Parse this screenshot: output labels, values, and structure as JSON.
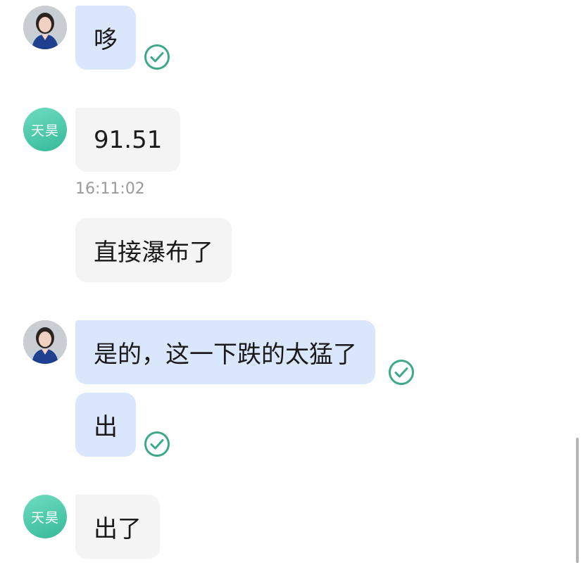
{
  "contacts": {
    "contact_avatar_label": "天昊"
  },
  "messages": [
    {
      "sender": "self",
      "text": "哆",
      "status": "read"
    },
    {
      "sender": "contact",
      "text": "91.51"
    },
    {
      "sender": "contact",
      "text": "直接瀑布了"
    },
    {
      "sender": "self",
      "text": "是的，这一下跌的太猛了",
      "status": "read"
    },
    {
      "sender": "self",
      "text": "出",
      "status": "read"
    },
    {
      "sender": "contact",
      "text": "出了"
    }
  ],
  "timestamps": [
    "16:11:02"
  ],
  "colors": {
    "self_bubble": "#d9e6fb",
    "contact_bubble": "#f4f4f4",
    "check_green": "#3ea88a",
    "contact_avatar": "#36b99a"
  },
  "icons": {
    "read_receipt": "check-circle-icon",
    "self_avatar": "user-photo"
  }
}
